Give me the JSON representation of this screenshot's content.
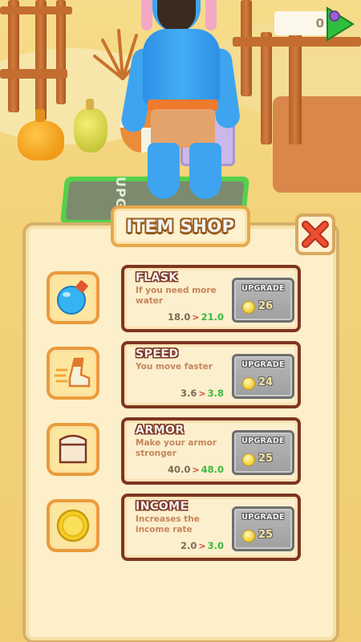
{
  "hud": {
    "currency_value": "0",
    "currency_icon": "green-gem-arrow-icon"
  },
  "background": {
    "pad_text": "UPGR"
  },
  "shop": {
    "title": "ITEM SHOP",
    "close_icon": "close-x-icon",
    "items": [
      {
        "name": "FLASK",
        "description": "If you need more water",
        "current": "18.0",
        "next": "21.0",
        "upgrade_label": "UPGRADE",
        "price": "26",
        "icon": "flask-icon"
      },
      {
        "name": "SPEED",
        "description": "You move faster",
        "current": "3.6",
        "next": "3.8",
        "upgrade_label": "UPGRADE",
        "price": "24",
        "icon": "boot-speed-icon"
      },
      {
        "name": "ARMOR",
        "description": "Make your armor stronger",
        "current": "40.0",
        "next": "48.0",
        "upgrade_label": "UPGRADE",
        "price": "25",
        "icon": "armor-icon"
      },
      {
        "name": "INCOME",
        "description": "Increases the income rate",
        "current": "2.0",
        "next": "3.0",
        "upgrade_label": "UPGRADE",
        "price": "25",
        "icon": "coin-icon"
      }
    ]
  },
  "colors": {
    "panel_bg": "#fcefc9",
    "card_border": "#7e3522",
    "accent_orange": "#ea9b3c",
    "next_value_green": "#3cb93e",
    "close_red": "#e8452b"
  }
}
